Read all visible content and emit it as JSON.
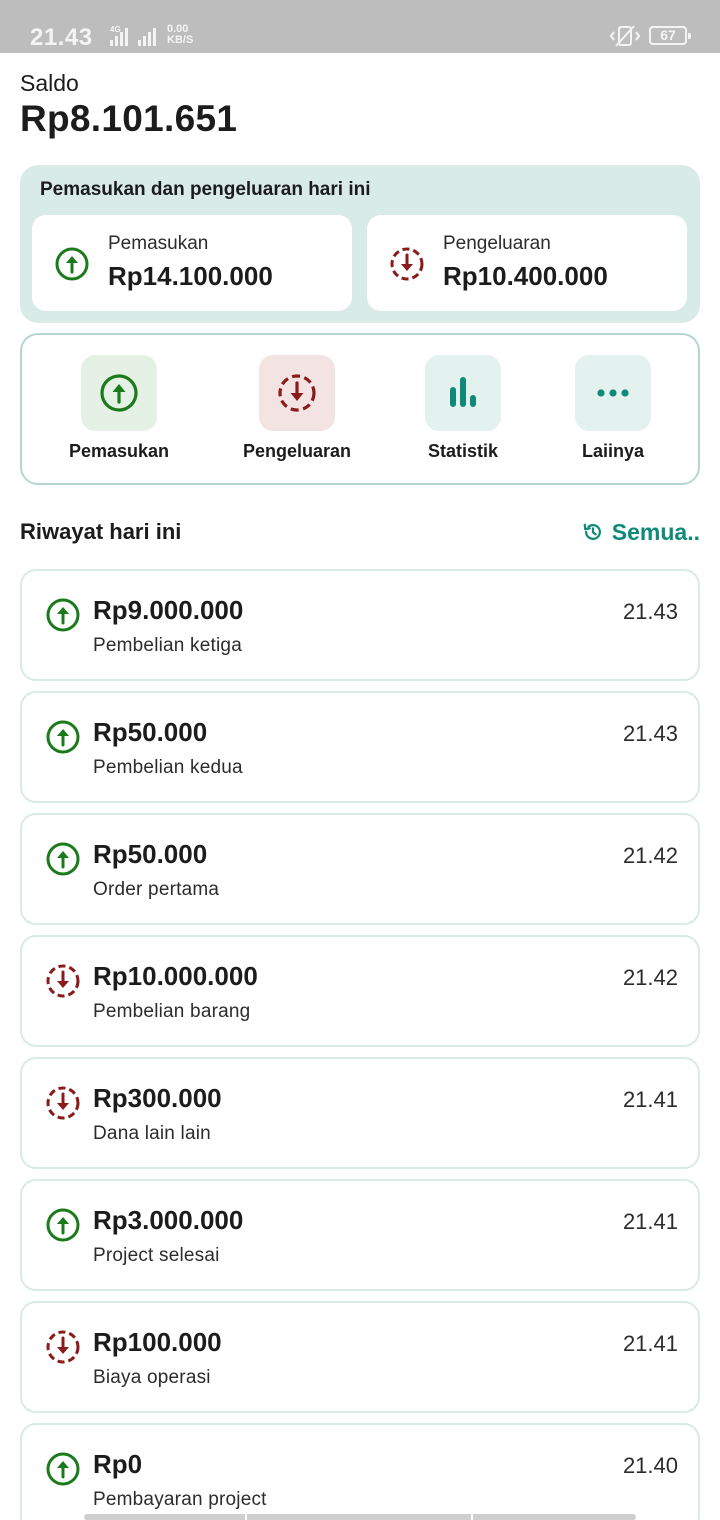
{
  "status_bar": {
    "time": "21.43",
    "network_speed": "0.00",
    "network_unit": "KB/S",
    "battery": "67"
  },
  "balance": {
    "label": "Saldo",
    "value": "Rp8.101.651"
  },
  "today_summary": {
    "title": "Pemasukan dan pengeluaran hari ini",
    "income_label": "Pemasukan",
    "income_value": "Rp14.100.000",
    "expense_label": "Pengeluaran",
    "expense_value": "Rp10.400.000"
  },
  "quick_menu": {
    "items": [
      {
        "label": "Pemasukan",
        "icon": "arrow-up-circle-icon"
      },
      {
        "label": "Pengeluaran",
        "icon": "arrow-down-dashed-circle-icon"
      },
      {
        "label": "Statistik",
        "icon": "bar-chart-icon"
      },
      {
        "label": "Laiinya",
        "icon": "more-dots-icon"
      }
    ]
  },
  "history": {
    "title": "Riwayat hari ini",
    "see_all": "Semua..",
    "items": [
      {
        "type": "income",
        "amount": "Rp9.000.000",
        "description": "Pembelian ketiga",
        "time": "21.43"
      },
      {
        "type": "income",
        "amount": "Rp50.000",
        "description": "Pembelian kedua",
        "time": "21.43"
      },
      {
        "type": "income",
        "amount": "Rp50.000",
        "description": "Order pertama",
        "time": "21.42"
      },
      {
        "type": "expense",
        "amount": "Rp10.000.000",
        "description": "Pembelian barang",
        "time": "21.42"
      },
      {
        "type": "expense",
        "amount": "Rp300.000",
        "description": "Dana lain lain",
        "time": "21.41"
      },
      {
        "type": "income",
        "amount": "Rp3.000.000",
        "description": "Project selesai",
        "time": "21.41"
      },
      {
        "type": "expense",
        "amount": "Rp100.000",
        "description": "Biaya operasi",
        "time": "21.41"
      },
      {
        "type": "income",
        "amount": "Rp0",
        "description": "Pembayaran project",
        "time": "21.40"
      }
    ]
  },
  "colors": {
    "income": "#1b7a1b",
    "expense": "#8b1a1a",
    "accent": "#0f8a78",
    "summary_bg": "#d9ebe7",
    "income_tile": "#e4f1e4",
    "expense_tile": "#f3e3e3",
    "neutral_tile": "#e3f1ef"
  }
}
